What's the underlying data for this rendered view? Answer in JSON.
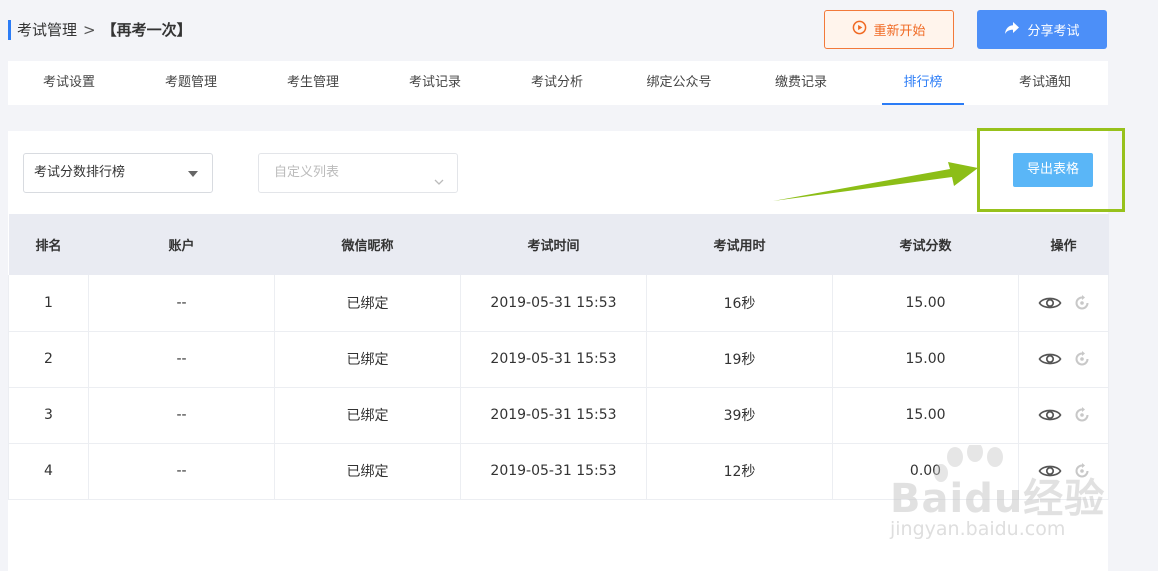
{
  "breadcrumb": {
    "root": "考试管理",
    "separator": ">",
    "current": "【再考一次】"
  },
  "actions": {
    "restart_label": "重新开始",
    "share_label": "分享考试"
  },
  "tabs": [
    {
      "label": "考试设置"
    },
    {
      "label": "考题管理"
    },
    {
      "label": "考生管理"
    },
    {
      "label": "考试记录"
    },
    {
      "label": "考试分析"
    },
    {
      "label": "绑定公众号"
    },
    {
      "label": "缴费记录"
    },
    {
      "label": "排行榜"
    },
    {
      "label": "考试通知"
    }
  ],
  "active_tab": "排行榜",
  "filters": {
    "ranking_select": "考试分数排行榜",
    "custom_list_placeholder": "自定义列表"
  },
  "export_label": "导出表格",
  "table": {
    "headers": [
      "排名",
      "账户",
      "微信昵称",
      "考试时间",
      "考试用时",
      "考试分数",
      "操作"
    ],
    "rows": [
      [
        "1",
        "--",
        "已绑定",
        "2019-05-31 15:53",
        "16秒",
        "15.00"
      ],
      [
        "2",
        "--",
        "已绑定",
        "2019-05-31 15:53",
        "19秒",
        "15.00"
      ],
      [
        "3",
        "--",
        "已绑定",
        "2019-05-31 15:53",
        "39秒",
        "15.00"
      ],
      [
        "4",
        "--",
        "已绑定",
        "2019-05-31 15:53",
        "12秒",
        "0.00"
      ]
    ],
    "row_actions": [
      "eye-icon",
      "refresh-icon"
    ]
  },
  "watermark": {
    "brand": "Baidu经验",
    "url": "jingyan.baidu.com"
  },
  "colors": {
    "accent": "#2b7cf6",
    "restart": "#f06a24",
    "share": "#4c8ff8",
    "export": "#5ab6f7",
    "highlight": "#97c11c"
  }
}
